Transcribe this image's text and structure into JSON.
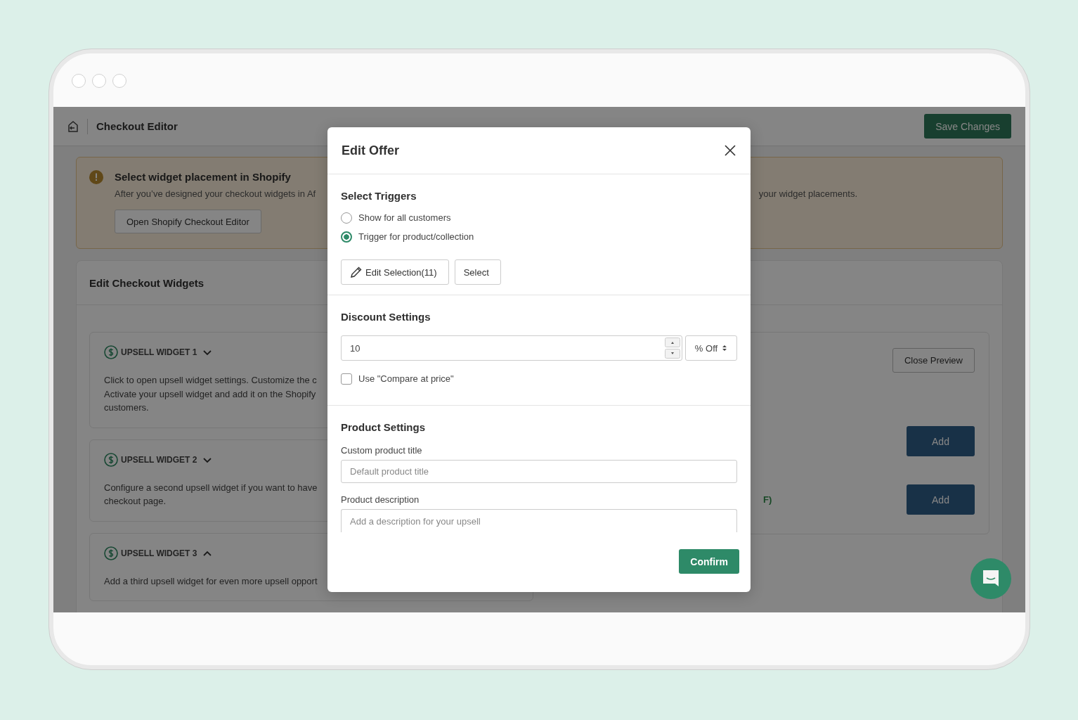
{
  "app": {
    "title": "Checkout Editor",
    "save_button": "Save Changes"
  },
  "banner": {
    "title": "Select widget placement in Shopify",
    "body_left": "After you’ve designed your checkout widgets in Af",
    "body_right": "your widget placements.",
    "button": "Open Shopify Checkout Editor"
  },
  "widgets_card": {
    "title": "Edit Checkout Widgets",
    "widgets": [
      {
        "title": "UPSELL WIDGET 1",
        "expanded": false,
        "lines": [
          "Click to open upsell widget settings. Customize the c",
          "Activate your upsell widget and add it on the Shopify",
          "customers."
        ]
      },
      {
        "title": "UPSELL WIDGET 2",
        "expanded": false,
        "lines": [
          "Configure a second upsell widget if you want to have",
          "checkout page."
        ]
      },
      {
        "title": "UPSELL WIDGET 3",
        "expanded": true,
        "lines": [
          "Add a third upsell widget for even more upsell opport"
        ]
      }
    ],
    "preview": {
      "close_button": "Close Preview",
      "fragment": "F)",
      "add_buttons": [
        "Add",
        "Add"
      ]
    }
  },
  "modal": {
    "title": "Edit Offer",
    "triggers": {
      "heading": "Select Triggers",
      "options": [
        {
          "label": "Show for all customers",
          "selected": false
        },
        {
          "label": "Trigger for product/collection",
          "selected": true
        }
      ],
      "edit_button": "Edit Selection(11)",
      "select_button": "Select"
    },
    "discount": {
      "heading": "Discount Settings",
      "value": "10",
      "unit": "% Off",
      "compare_label": "Use \"Compare at price\"",
      "compare_checked": false
    },
    "product": {
      "heading": "Product Settings",
      "fields": [
        {
          "label": "Custom product title",
          "placeholder": "Default product title"
        },
        {
          "label": "Product description",
          "placeholder": "Add a description for your upsell"
        }
      ]
    },
    "confirm_button": "Confirm"
  }
}
